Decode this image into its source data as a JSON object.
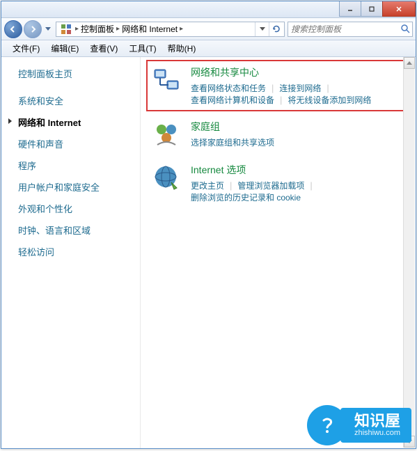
{
  "breadcrumb": {
    "item1": "控制面板",
    "item2": "网络和 Internet"
  },
  "search": {
    "placeholder": "搜索控制面板"
  },
  "menu": {
    "file": "文件(F)",
    "edit": "编辑(E)",
    "view": "查看(V)",
    "tools": "工具(T)",
    "help": "帮助(H)"
  },
  "sidebar": {
    "home": "控制面板主页",
    "items": [
      "系统和安全",
      "网络和 Internet",
      "硬件和声音",
      "程序",
      "用户帐户和家庭安全",
      "外观和个性化",
      "时钟、语言和区域",
      "轻松访问"
    ]
  },
  "categories": {
    "network": {
      "title": "网络和共享中心",
      "links": [
        "查看网络状态和任务",
        "连接到网络",
        "查看网络计算机和设备",
        "将无线设备添加到网络"
      ]
    },
    "homegroup": {
      "title": "家庭组",
      "links": [
        "选择家庭组和共享选项"
      ]
    },
    "internet": {
      "title": "Internet 选项",
      "links": [
        "更改主页",
        "管理浏览器加载项",
        "删除浏览的历史记录和 cookie"
      ]
    }
  },
  "watermark": {
    "title": "知识屋",
    "sub": "zhishiwu.com"
  }
}
